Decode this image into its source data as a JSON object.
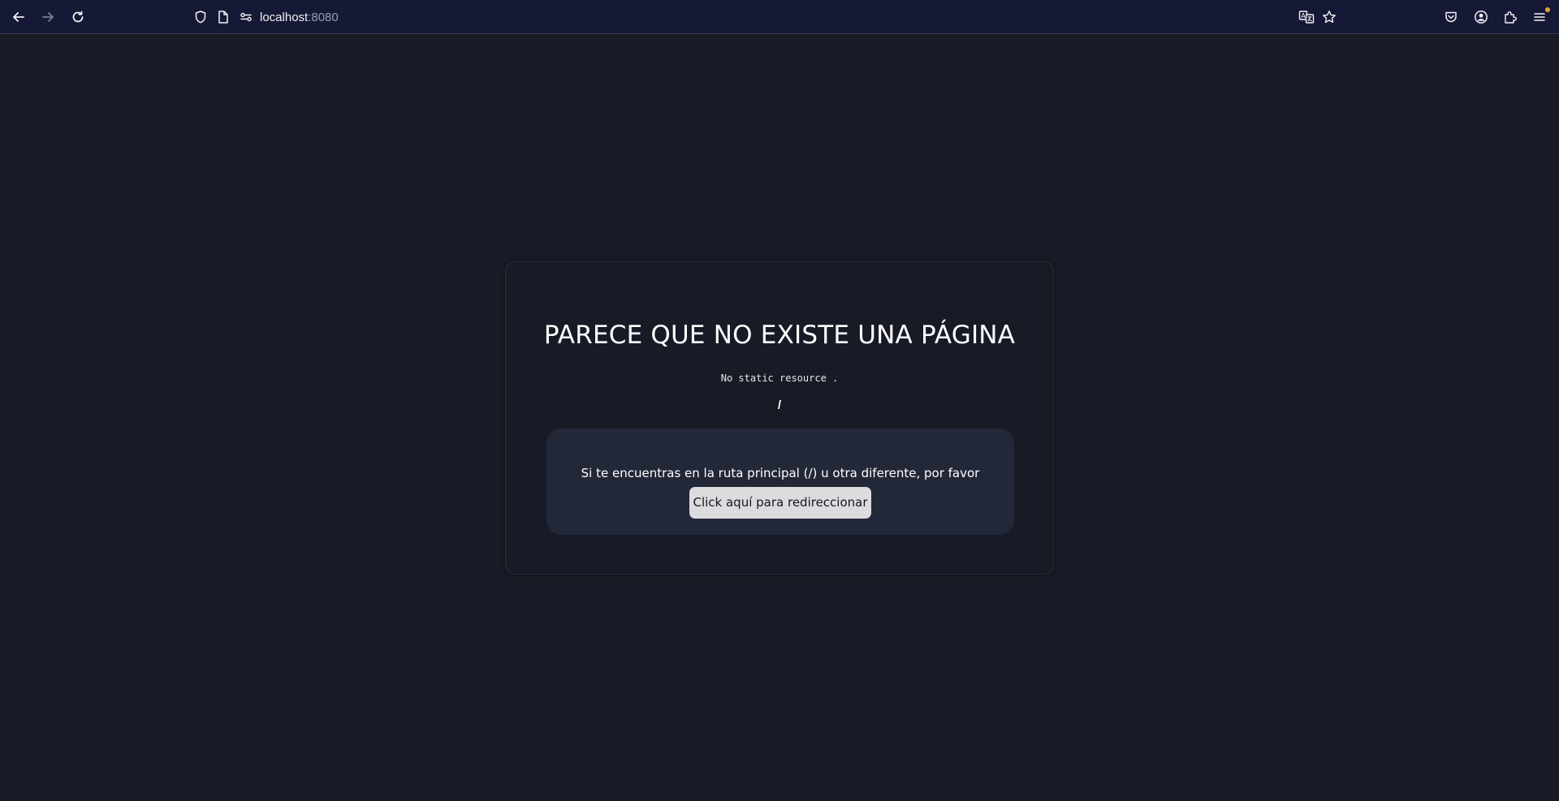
{
  "browser": {
    "url_host": "localhost",
    "url_port": ":8080",
    "icons": {
      "back": "back-arrow-icon",
      "forward": "forward-arrow-icon",
      "reload": "reload-icon",
      "shield": "shield-icon",
      "page": "page-icon",
      "permissions": "permissions-icon",
      "translate": "translate-icon",
      "bookmark": "star-icon",
      "pocket": "pocket-icon",
      "account": "account-icon",
      "extensions": "extensions-icon",
      "menu": "menu-icon"
    },
    "colors": {
      "toolbar": "#161936",
      "badge": "#e8a23a"
    }
  },
  "page": {
    "title": "PARECE QUE NO EXISTE UNA PÁGINA",
    "error_message": "No static resource .",
    "path": "/",
    "notice_text": "Si te encuentras en la ruta principal (/) u otra diferente, por favor",
    "redirect_button_label": "Click aquí para redireccionar",
    "colors": {
      "background": "#181b26",
      "notice_box": "#232839",
      "button": "#dcdcdf"
    }
  }
}
